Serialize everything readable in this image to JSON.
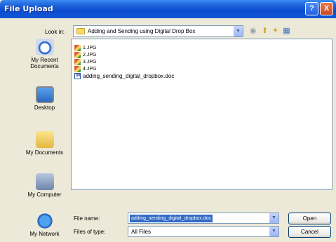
{
  "window": {
    "title": "File Upload"
  },
  "titlebar": {
    "help_label": "?",
    "close_label": "X"
  },
  "lookin": {
    "label": "Look in:",
    "value": "Adding and Sending using Digital Drop Box"
  },
  "toolbar_icons": [
    "back-icon",
    "up-one-level-icon",
    "new-folder-icon",
    "views-menu-icon"
  ],
  "places": [
    {
      "label": "My Recent Documents",
      "icon": "recent-documents-icon"
    },
    {
      "label": "Desktop",
      "icon": "desktop-icon"
    },
    {
      "label": "My Documents",
      "icon": "my-documents-icon"
    },
    {
      "label": "My Computer",
      "icon": "my-computer-icon"
    },
    {
      "label": "My Network",
      "icon": "my-network-icon"
    }
  ],
  "files": [
    {
      "name": "1.JPG",
      "icon": "image-file-icon"
    },
    {
      "name": "2.JPG",
      "icon": "image-file-icon"
    },
    {
      "name": "3.JPG",
      "icon": "image-file-icon"
    },
    {
      "name": "4.JPG",
      "icon": "image-file-icon"
    },
    {
      "name": "adding_sending_digital_dropbox.doc",
      "icon": "word-doc-icon"
    }
  ],
  "filename": {
    "label": "File name:",
    "value": "adding_sending_digital_dropbox.doc"
  },
  "filetype": {
    "label": "Files of type:",
    "value": "All Files"
  },
  "buttons": {
    "open": "Open",
    "cancel": "Cancel"
  },
  "colors": {
    "titlebar": "#0c4bd0",
    "selection": "#316ac5",
    "dialog_bg": "#ece9d8"
  }
}
